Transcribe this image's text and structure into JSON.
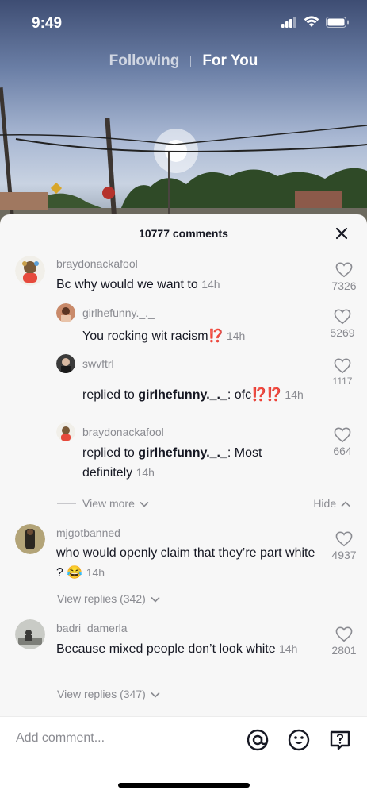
{
  "status_bar": {
    "time": "9:49"
  },
  "feed_tabs": {
    "following": "Following",
    "for_you": "For You"
  },
  "comments_sheet": {
    "count_label": "10777 comments",
    "comments": [
      {
        "username": "braydonackafool",
        "text": "Bc why would we want to",
        "time": "14h",
        "likes": "7326",
        "replies": [
          {
            "username": "girlhefunny._._",
            "text": "You rocking wit racism",
            "emoji": "⁉️",
            "time": "14h",
            "likes": "5269"
          },
          {
            "username": "swvftrl",
            "prefix": "replied to ",
            "mention": "girlhefunny._._",
            "text": ": ofc",
            "emoji": "⁉️⁉️",
            "time": "14h",
            "likes": "1117"
          },
          {
            "username": "braydonackafool",
            "prefix": "replied to ",
            "mention": "girlhefunny._._",
            "text": ": Most definitely",
            "time": "14h",
            "likes": "664"
          }
        ],
        "view_more": "View more",
        "hide": "Hide"
      },
      {
        "username": "mjgotbanned",
        "text": "who would openly claim that they’re part white ?",
        "emoji": "😂",
        "time": "14h",
        "likes": "4937",
        "view_replies": "View replies (342)"
      },
      {
        "username": "badri_damerla",
        "text": "Because mixed people don’t look white",
        "time": "14h",
        "likes": "2801",
        "view_replies": "View replies (347)"
      }
    ]
  },
  "bottom_bar": {
    "placeholder": "Add comment...",
    "icons": [
      "at-icon",
      "emoji-icon",
      "question-comment-icon"
    ]
  }
}
